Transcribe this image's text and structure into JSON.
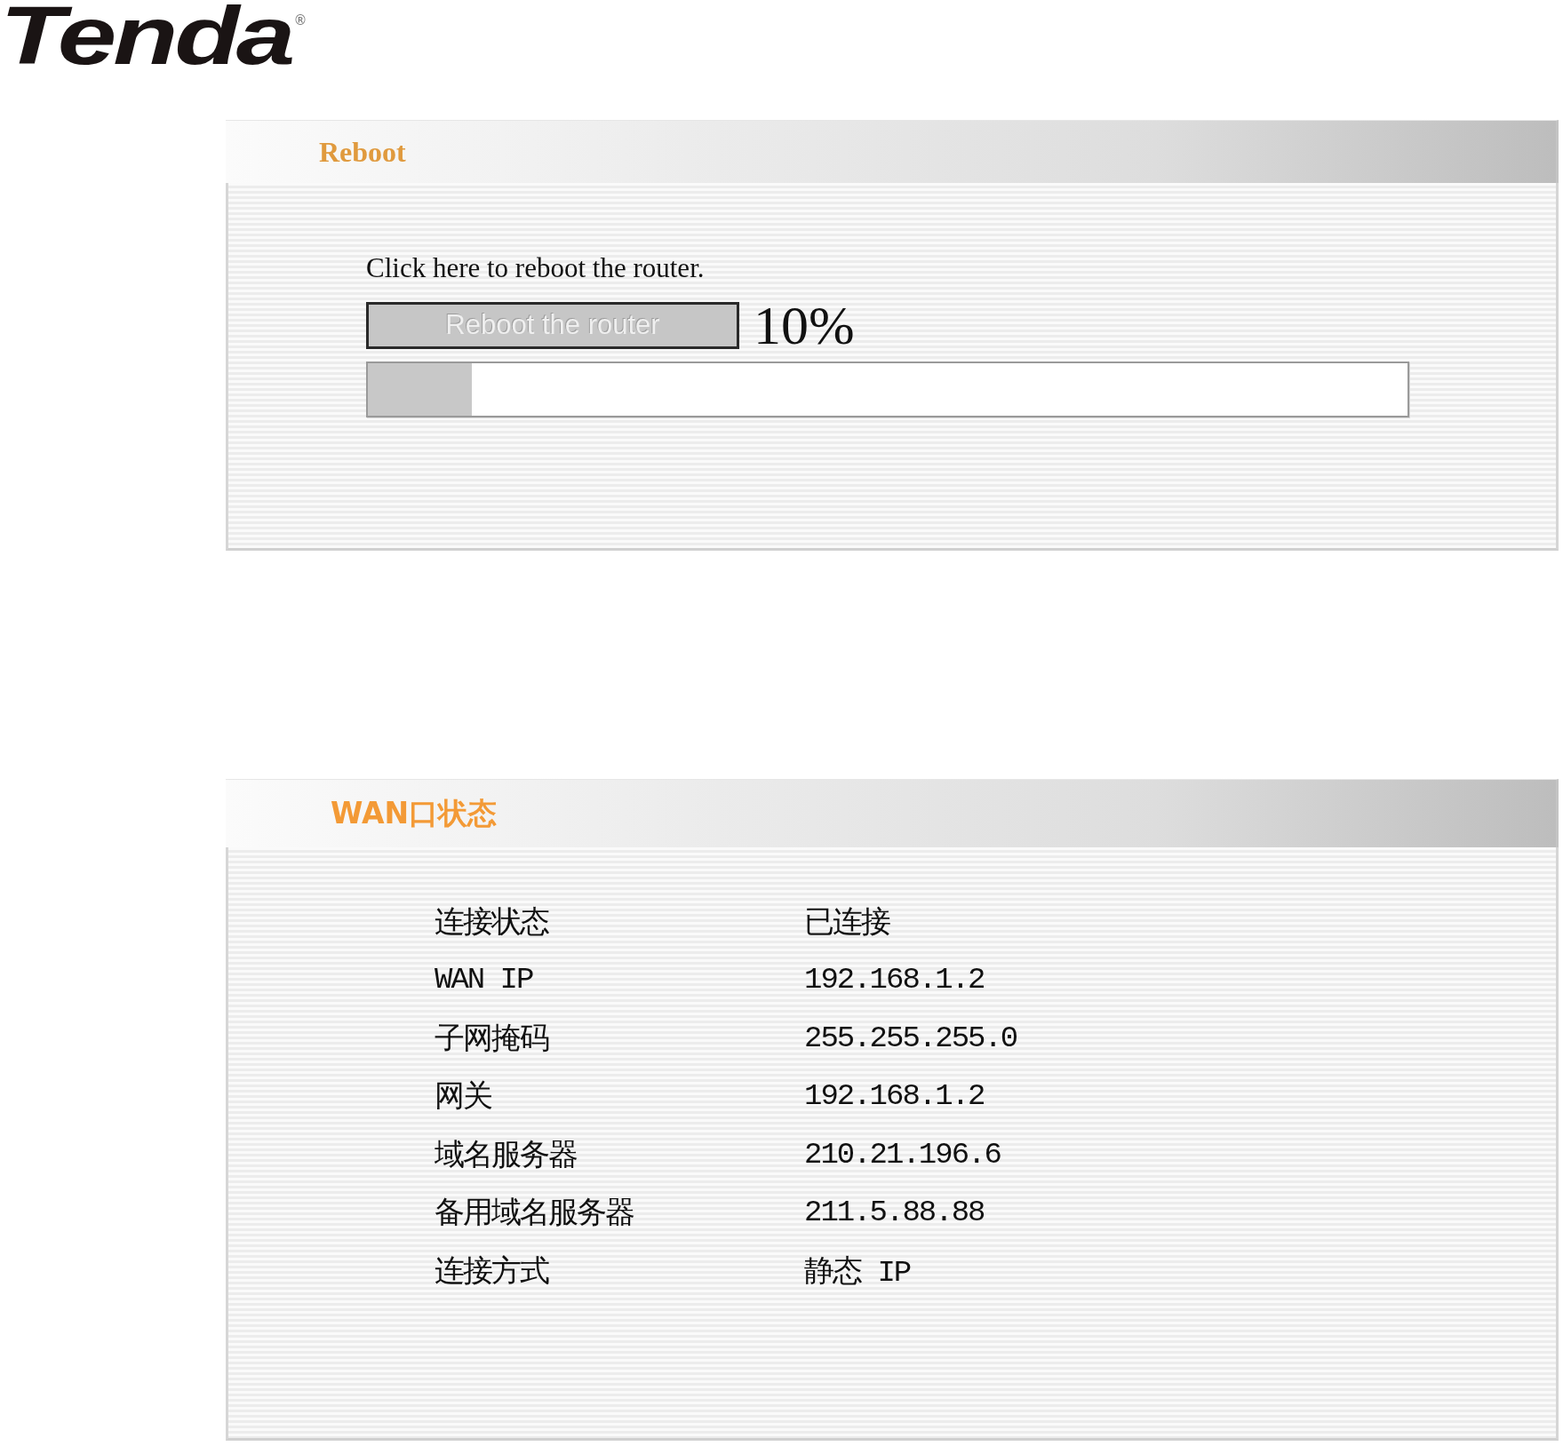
{
  "logo": {
    "text": "Tenda",
    "mark": "®"
  },
  "reboot_panel": {
    "title": "Reboot",
    "hint": "Click here to reboot the router.",
    "button": {
      "label": "Reboot the router",
      "disabled": true
    },
    "percent": "10%",
    "progress": {
      "level": 0.1
    }
  },
  "wan_panel": {
    "title": "WAN口状态",
    "rows": [
      {
        "label": "连接状态",
        "value": "已连接"
      },
      {
        "label": "WAN IP",
        "value": "192.168.1.2"
      },
      {
        "label": "子网掩码",
        "value": "255.255.255.0"
      },
      {
        "label": "网关",
        "value": "192.168.1.2"
      },
      {
        "label": "域名服务器",
        "value": "210.21.196.6"
      },
      {
        "label": "备用域名服务器",
        "value": "211.5.88.88"
      },
      {
        "label": "连接方式",
        "value": "静态 IP"
      }
    ]
  }
}
